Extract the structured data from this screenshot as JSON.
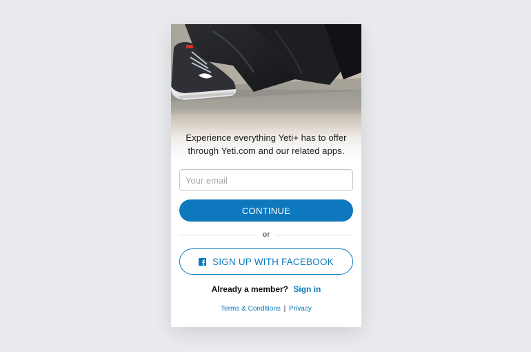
{
  "hero": {
    "image_description_icon": "running-shoe-photo",
    "line1": "Experience everything Yeti+ has to offer",
    "line2": "through Yeti.com and our related apps."
  },
  "email": {
    "placeholder": "Your email",
    "value": ""
  },
  "continue_button": {
    "label": "CONTINUE"
  },
  "divider": {
    "label": "or"
  },
  "facebook_button": {
    "icon": "facebook-icon",
    "label": "SIGN UP WITH FACEBOOK"
  },
  "member": {
    "prompt": "Already a member?",
    "sign_in_label": "Sign in"
  },
  "footer": {
    "terms_label": "Terms & Conditions",
    "separator": "|",
    "privacy_label": "Privacy"
  },
  "colors": {
    "accent": "#0d78bd",
    "background": "#e9ebee",
    "card": "#ffffff"
  }
}
